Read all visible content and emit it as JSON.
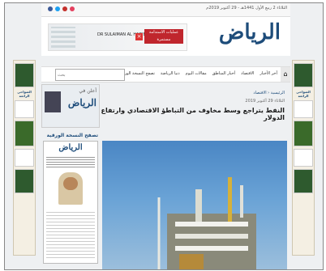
{
  "topbar": {
    "date": "الثلاثاء 2 ربيع الأول 1441هـ - 29 أكتوبر 2019م"
  },
  "header": {
    "logo_text": "الرياض",
    "ad_right_text": "عمليات الاستدامة مستمرة",
    "ad_brand": "DR SULAIMAN AL HABIB"
  },
  "nav": {
    "items": [
      "آخر الأخبار",
      "الاقتصاد",
      "أخبار المناطق",
      "مقالات اليوم",
      "دنيا الرياضة",
      "تصفح النسخة الورقية"
    ]
  },
  "search": {
    "placeholder": "بحث"
  },
  "breadcrumb": "الرئيسية ‹ الاقتصاد",
  "article": {
    "meta": "الثلاثاء 29 أكتوبر 2019",
    "title": "النفط يتراجع وسط مخاوف من التباطؤ الاقتصادي وارتفاع الدولار"
  },
  "left": {
    "ad_line1": "أعلن في",
    "ad_line2": "الرياض",
    "pdf_heading": "تصفح النسخة الورقية",
    "paper_masthead": "الرياض"
  },
  "side": {
    "label": "الضواحي الرائعة"
  }
}
